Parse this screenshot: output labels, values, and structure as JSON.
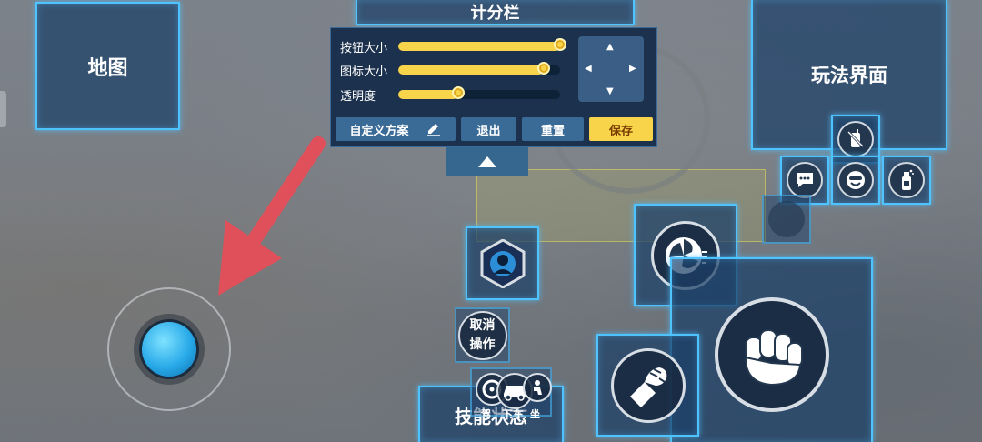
{
  "panels": {
    "map": "地图",
    "scoreboard": "计分栏",
    "gameplay_ui": "玩法界面",
    "skill_status": "技能状态"
  },
  "settings": {
    "sliders": [
      {
        "label": "按钮大小",
        "value": 1.0
      },
      {
        "label": "图标大小",
        "value": 0.9
      },
      {
        "label": "透明度",
        "value": 0.37
      }
    ],
    "buttons": {
      "custom_scheme": "自定义方案",
      "exit": "退出",
      "reset": "重置",
      "save": "保存"
    }
  },
  "controls": {
    "cancel_action": "取消\n操作",
    "vehicle_labels": {
      "drive": "驾",
      "get_off": "下车",
      "sit": "坐"
    }
  },
  "icons": {
    "edit": "pencil-icon",
    "collapse": "triangle-up-icon",
    "dpad": "dpad-icon",
    "voice_mute": "walkie-talkie-muted-icon",
    "chat": "chat-bubble-icon",
    "emoji": "smile-icon",
    "spray": "spray-can-icon",
    "dash": "dash-swirl-icon",
    "punch": "fist-icon",
    "grab": "grab-hand-icon",
    "skill": "skill-avatar-icon",
    "car": "car-icon"
  },
  "colors": {
    "panel_border": "#4fc3ff",
    "accent_yellow": "#f7d44a",
    "arrow_red": "#e0505a"
  }
}
